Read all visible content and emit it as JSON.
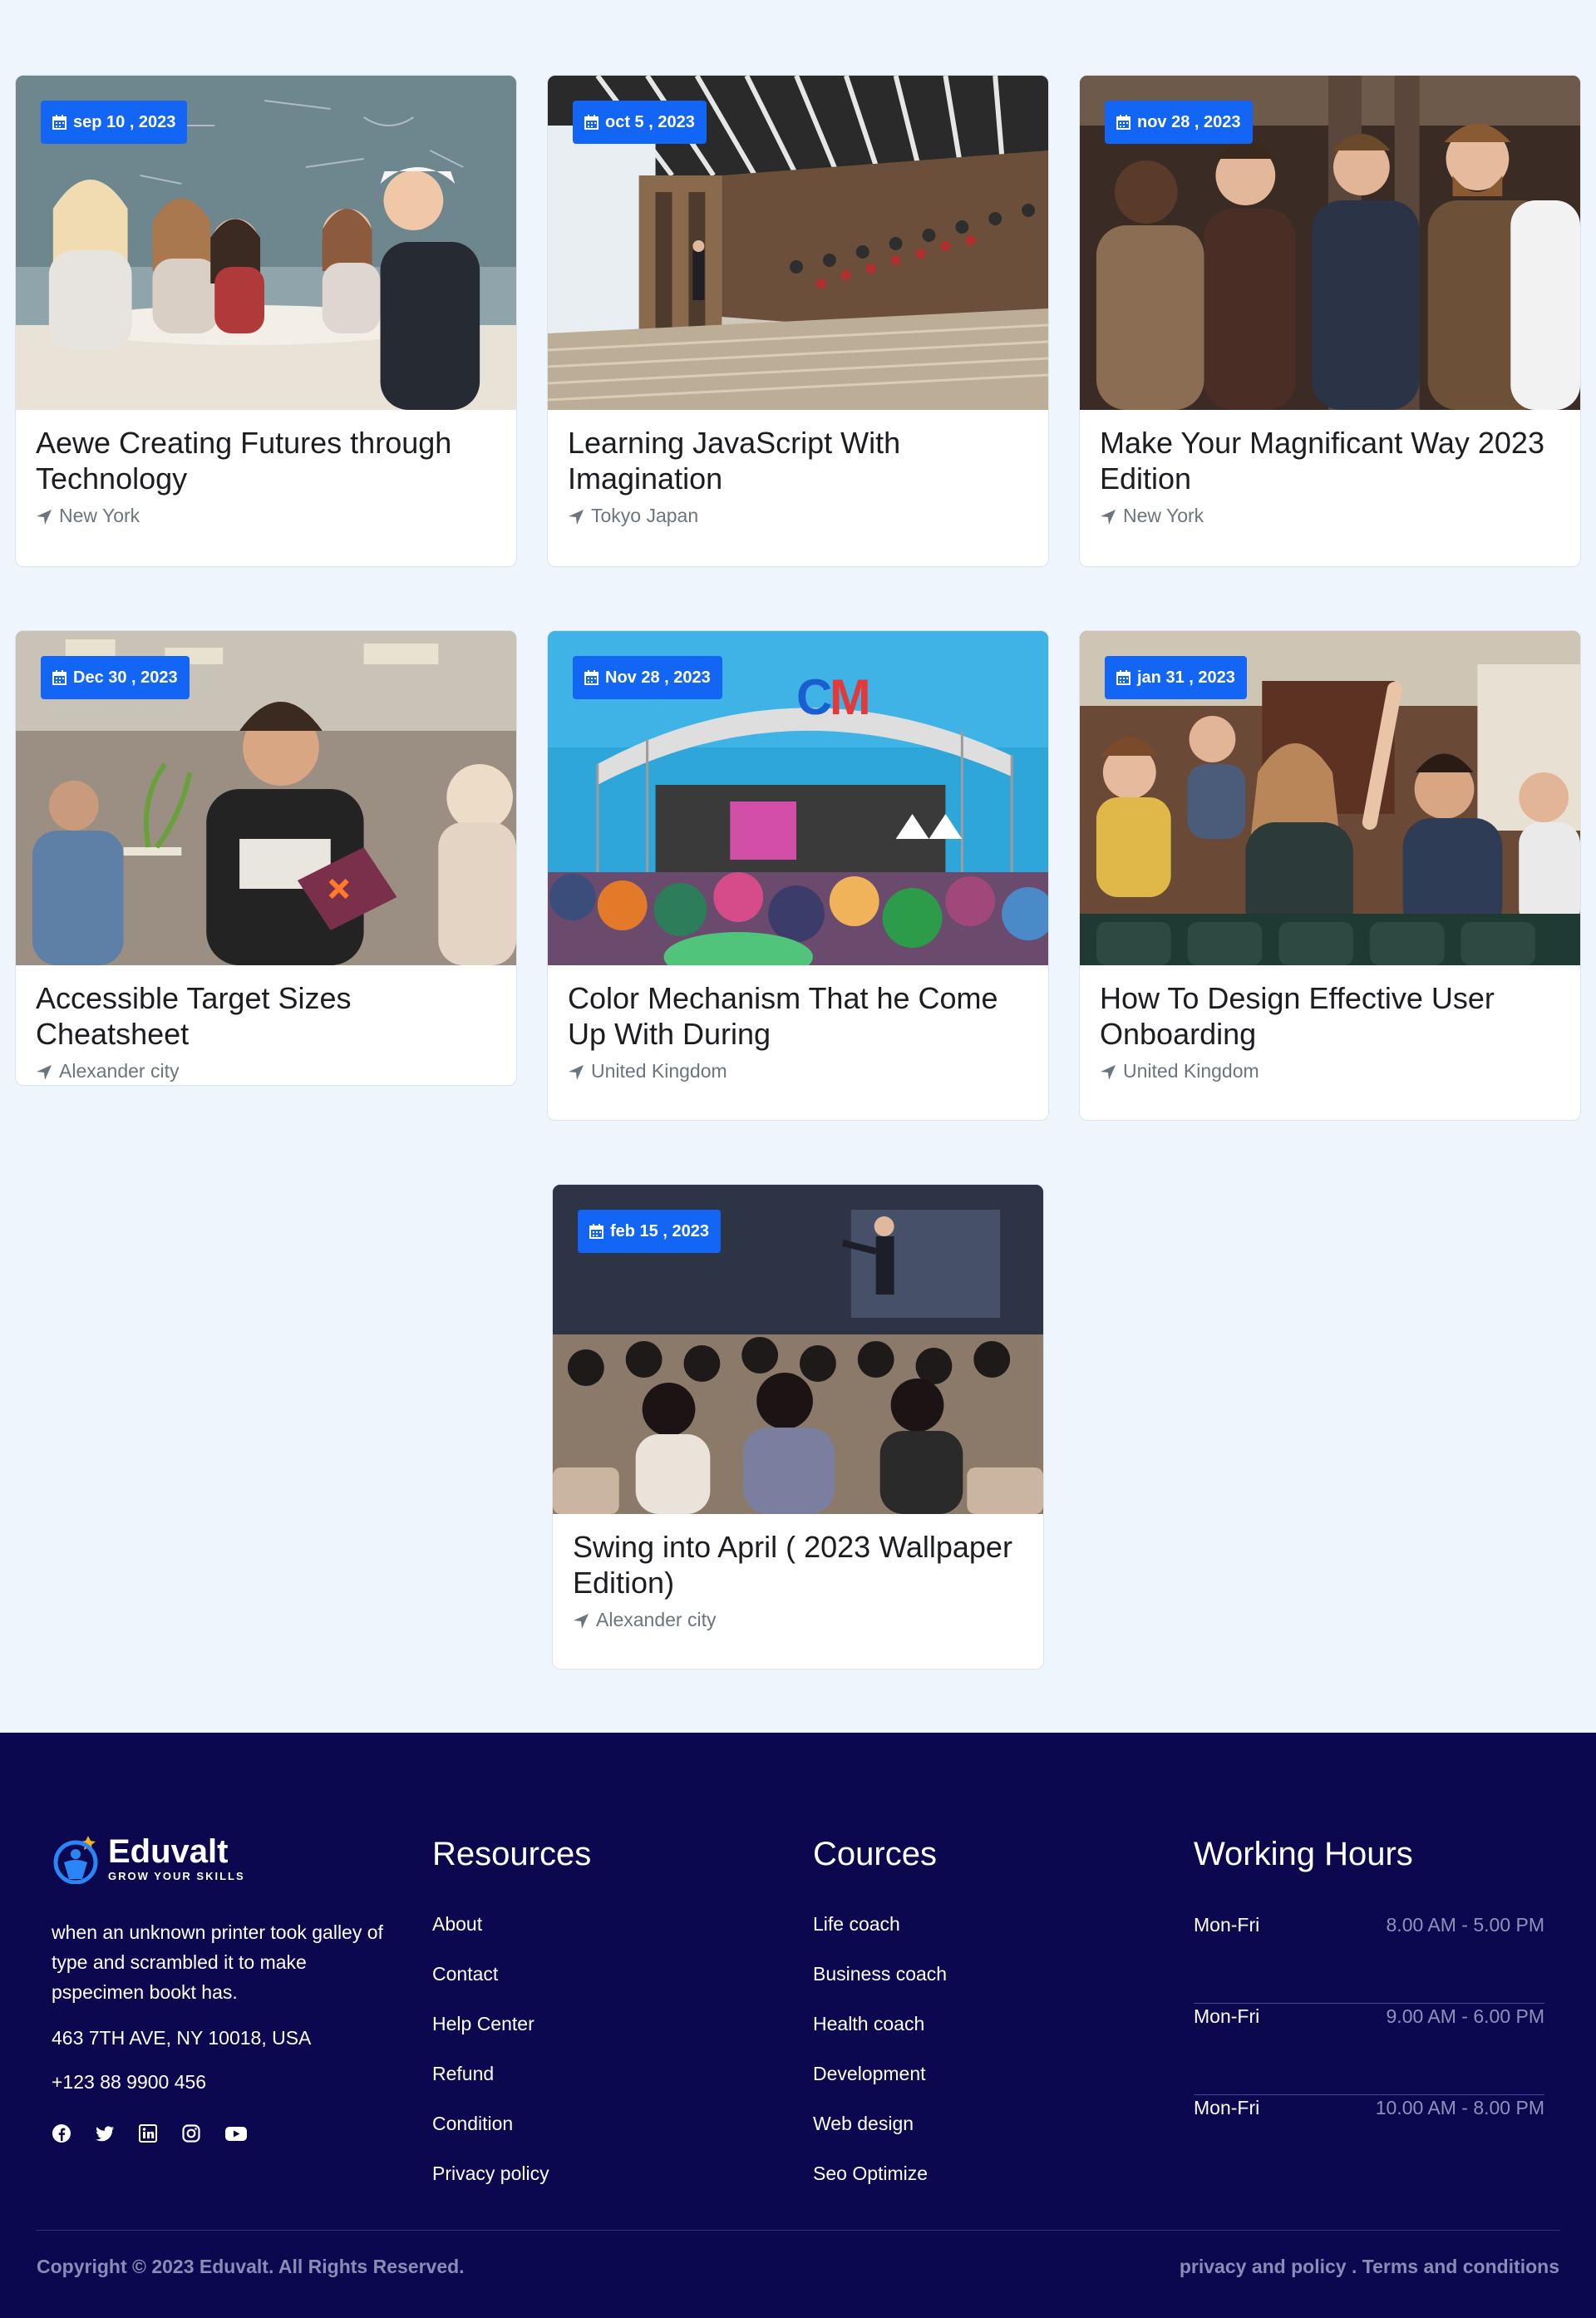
{
  "events": [
    {
      "date": "sep 10 , 2023",
      "title": "Aewe Creating Futures through Technology",
      "location": "New York",
      "photo": "classroom"
    },
    {
      "date": "oct 5 , 2023",
      "title": "Learning JavaScript With Imagination",
      "location": "Tokyo Japan",
      "photo": "lecture-hall"
    },
    {
      "date": "nov 28 , 2023",
      "title": "Make Your Magnificant Way 2023 Edition",
      "location": "New York",
      "photo": "business-men"
    },
    {
      "date": "Dec 30 , 2023",
      "title": "Accessible Target Sizes Cheatsheet",
      "location": "Alexander city",
      "photo": "student-tablet"
    },
    {
      "date": "Nov 28 , 2023",
      "title": "Color Mechanism That he Come Up With During",
      "location": "United Kingdom",
      "photo": "festival"
    },
    {
      "date": "jan 31 , 2023",
      "title": "How To Design Effective User Onboarding",
      "location": "United Kingdom",
      "photo": "audience-hands"
    },
    {
      "date": "feb 15 , 2023",
      "title": "Swing into April ( 2023 Wallpaper Edition)",
      "location": "Alexander city",
      "photo": "conference-speaker"
    }
  ],
  "footer": {
    "brand": "Eduvalt",
    "tagline": "GROW YOUR SKILLS",
    "about": "when an unknown printer took galley of type and scrambled it to make pspecimen bookt has.",
    "address": "463 7TH AVE, NY 10018, USA",
    "phone": "+123 88 9900 456",
    "socials": [
      "facebook-icon",
      "twitter-icon",
      "linkedin-icon",
      "instagram-icon",
      "youtube-icon"
    ],
    "resources": {
      "title": "Resources",
      "items": [
        "About",
        "Contact",
        "Help Center",
        "Refund",
        "Condition",
        "Privacy policy"
      ]
    },
    "courses": {
      "title": "Cources",
      "items": [
        "Life coach",
        "Business coach",
        "Health coach",
        "Development",
        "Web design",
        "Seo Optimize"
      ]
    },
    "hours": {
      "title": "Working Hours",
      "rows": [
        {
          "day": "Mon-Fri",
          "time": "8.00 AM - 5.00 PM"
        },
        {
          "day": "Mon-Fri",
          "time": "9.00 AM - 6.00 PM"
        },
        {
          "day": "Mon-Fri",
          "time": "10.00 AM - 8.00 PM"
        }
      ]
    },
    "copyright": "Copyright © 2023 Eduvalt. All Rights Reserved.",
    "legal_links": "privacy and policy . Terms and conditions"
  },
  "colors": {
    "accent": "#1366f5",
    "footer_bg": "#0b0850",
    "page_bg": "#eef5fd"
  }
}
